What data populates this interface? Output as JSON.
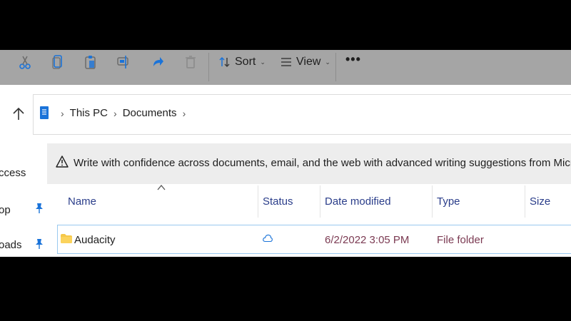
{
  "toolbar": {
    "icons": [
      "cut-icon",
      "copy-icon",
      "paste-icon",
      "rename-icon",
      "share-icon",
      "delete-icon"
    ],
    "sort_label": "Sort",
    "view_label": "View",
    "more_label": "•••"
  },
  "address": {
    "crumbs": [
      "This PC",
      "Documents"
    ],
    "separator": "›"
  },
  "nav": {
    "items": [
      "ccess",
      "op",
      "oads"
    ]
  },
  "banner": {
    "text": "Write with confidence across documents, email, and the web with advanced writing suggestions from Microsoft Editor"
  },
  "columns": {
    "name": "Name",
    "status": "Status",
    "date": "Date modified",
    "type": "Type",
    "size": "Size"
  },
  "rows": [
    {
      "name": "Audacity",
      "status_icon": "cloud-icon",
      "date": "6/2/2022 3:05 PM",
      "type": "File folder",
      "size": ""
    }
  ],
  "colors": {
    "toolbar_bg": "#a5a5a5",
    "accent": "#1a73d9",
    "header_text": "#2a3d8a",
    "meta_text": "#7b3a52"
  }
}
